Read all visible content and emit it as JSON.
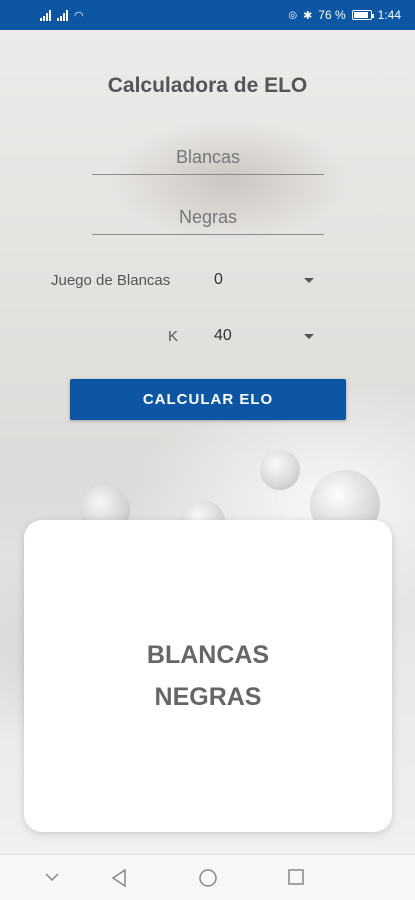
{
  "status_bar": {
    "battery_percent": "76 %",
    "time": "1:44",
    "battery_level": 0.76,
    "color": "#0d56a3"
  },
  "app": {
    "title": "Calculadora de ELO"
  },
  "form": {
    "white_placeholder": "Blancas",
    "black_placeholder": "Negras",
    "game_label": "Juego de Blancas",
    "game_value": "0",
    "k_label": "K",
    "k_value": "40",
    "calculate_label": "CALCULAR ELO"
  },
  "result": {
    "line1": "BLANCAS",
    "line2": "NEGRAS"
  },
  "navbar": {
    "icons": [
      "chevron-down-icon",
      "back-icon",
      "home-icon",
      "recents-icon"
    ]
  },
  "colors": {
    "accent": "#0d56a3"
  }
}
